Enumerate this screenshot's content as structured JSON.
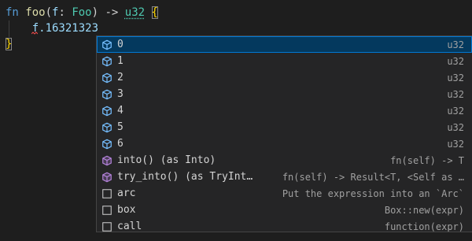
{
  "code": {
    "line1": {
      "kw_fn": "fn",
      "fn_name": "foo",
      "open_paren": "(",
      "param": "f",
      "colon": ": ",
      "param_type": "Foo",
      "close_paren": ")",
      "arrow": " -> ",
      "ret_type": "u32",
      "open_brace": "{"
    },
    "line2": {
      "indent": "    ",
      "text": "f.16321323"
    },
    "line3": {
      "close_brace": "}"
    }
  },
  "suggest": {
    "items": [
      {
        "label": "0",
        "detail": "u32",
        "icon": "field-icon",
        "selected": true
      },
      {
        "label": "1",
        "detail": "u32",
        "icon": "field-icon"
      },
      {
        "label": "2",
        "detail": "u32",
        "icon": "field-icon"
      },
      {
        "label": "3",
        "detail": "u32",
        "icon": "field-icon"
      },
      {
        "label": "4",
        "detail": "u32",
        "icon": "field-icon"
      },
      {
        "label": "5",
        "detail": "u32",
        "icon": "field-icon"
      },
      {
        "label": "6",
        "detail": "u32",
        "icon": "field-icon"
      },
      {
        "label": "into() (as Into)",
        "detail": "fn(self) -> T",
        "icon": "method-icon"
      },
      {
        "label": "try_into() (as TryInt…",
        "detail": "fn(self) -> Result<T, <Self as …",
        "icon": "method-icon"
      },
      {
        "label": "arc",
        "detail": "Put the expression into an `Arc`",
        "icon": "snippet-icon"
      },
      {
        "label": "box",
        "detail": "Box::new(expr)",
        "icon": "snippet-icon"
      },
      {
        "label": "call",
        "detail": "function(expr)",
        "icon": "snippet-icon"
      }
    ]
  },
  "colors": {
    "background": "#1e1e1e",
    "suggest_background": "#252526",
    "selected_row": "#04395e",
    "field_icon": "#75beff",
    "method_icon": "#b180d7",
    "match_highlight": "#18a3ff"
  }
}
